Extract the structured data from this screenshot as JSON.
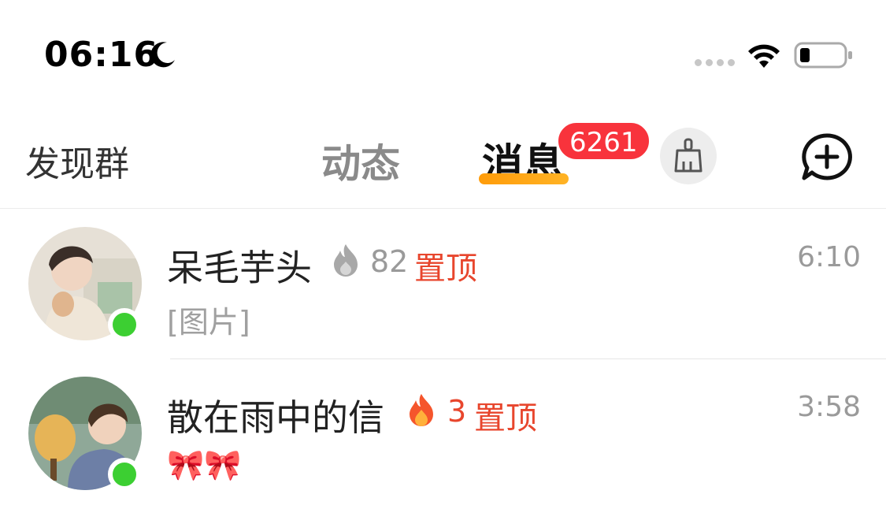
{
  "status_bar": {
    "time": "06:16",
    "icons": [
      "moon-icon",
      "signal-dots-icon",
      "wifi-icon",
      "battery-icon"
    ]
  },
  "nav": {
    "discover_label": "发现群",
    "tabs": [
      {
        "label": "动态",
        "active": false
      },
      {
        "label": "消息",
        "active": true
      }
    ],
    "message_badge": "6261",
    "right_icons": [
      "broom-icon",
      "chat-add-icon"
    ],
    "accent_color": "#ff9c0a",
    "badge_color": "#f8333c"
  },
  "chats": [
    {
      "name": "呆毛芋头",
      "flame_icon": "flame-gray-icon",
      "streak": "82",
      "pin_label": "置顶",
      "time": "6:10",
      "preview": "[图片]",
      "online": true
    },
    {
      "name": "散在雨中的信",
      "flame_icon": "flame-orange-icon",
      "streak": "3",
      "pin_label": "置顶",
      "time": "3:58",
      "preview": "🎀🎀",
      "online": true
    }
  ]
}
